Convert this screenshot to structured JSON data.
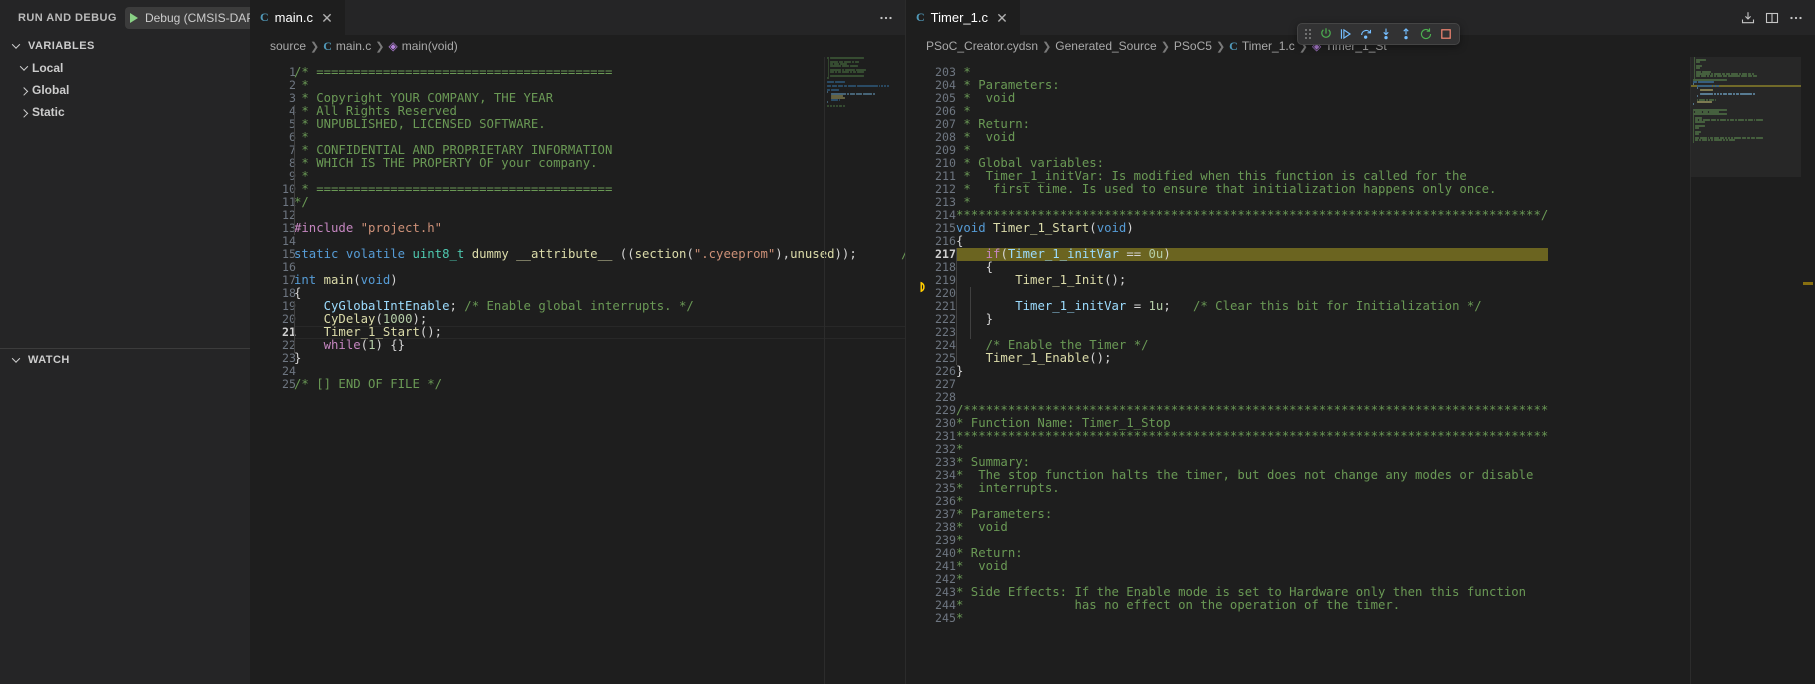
{
  "sidebar": {
    "title": "RUN AND DEBUG",
    "launch_config": "Debug (CMSIS-DAP)",
    "settings_icon": "gear-icon",
    "more_icon": "ellipsis-icon",
    "sections": [
      {
        "label": "VARIABLES",
        "expanded": true
      },
      {
        "label": "WATCH",
        "expanded": true
      }
    ],
    "variables_tree": [
      {
        "label": "Local",
        "expanded": true,
        "indent": 1
      },
      {
        "label": "Global",
        "expanded": false,
        "indent": 1
      },
      {
        "label": "Static",
        "expanded": false,
        "indent": 1
      }
    ]
  },
  "editor_left": {
    "tab": {
      "label": "main.c",
      "file_icon": "c-file-icon",
      "close_icon": "close-icon",
      "active": true
    },
    "tabbar_more_icon": "ellipsis-icon",
    "breadcrumbs": [
      "source",
      "main.c",
      "main(void)"
    ],
    "first_line": 1,
    "current_line": 21,
    "lines": [
      "/* ========================================",
      " *",
      " * Copyright YOUR COMPANY, THE YEAR",
      " * All Rights Reserved",
      " * UNPUBLISHED, LICENSED SOFTWARE.",
      " *",
      " * CONFIDENTIAL AND PROPRIETARY INFORMATION",
      " * WHICH IS THE PROPERTY OF your company.",
      " *",
      " * ========================================",
      "*/",
      "",
      "#include \"project.h\"",
      "",
      "static volatile uint8_t dummy __attribute__ ((section(\".cyeeprom\"),unused));      // Fix for lin",
      "",
      "int main(void)",
      "{",
      "    CyGlobalIntEnable; /* Enable global interrupts. */",
      "    CyDelay(1000);",
      "    Timer_1_Start();",
      "    while(1) {}",
      "}",
      "",
      "/* [] END OF FILE */"
    ]
  },
  "editor_right": {
    "tab": {
      "label": "Timer_1.c",
      "file_icon": "c-file-icon",
      "close_icon": "close-icon",
      "active": true
    },
    "breadcrumbs": [
      "PSoC_Creator.cydsn",
      "Generated_Source",
      "PSoC5",
      "Timer_1.c",
      "Timer_1_St"
    ],
    "actions": [
      {
        "name": "save-to-disk-icon"
      },
      {
        "name": "split-editor-icon"
      },
      {
        "name": "more-actions-icon"
      }
    ],
    "first_line": 203,
    "execution_line": 217,
    "lines": [
      " *",
      " * Parameters:",
      " *  void",
      " *",
      " * Return:",
      " *  void",
      " *",
      " * Global variables:",
      " *  Timer_1_initVar: Is modified when this function is called for the",
      " *   first time. Is used to ensure that initialization happens only once.",
      " *",
      "*******************************************************************************/",
      "void Timer_1_Start(void)",
      "{",
      "    if(Timer_1_initVar == 0u)",
      "    {",
      "        Timer_1_Init();",
      "",
      "        Timer_1_initVar = 1u;   /* Clear this bit for Initialization */",
      "    }",
      "",
      "    /* Enable the Timer */",
      "    Timer_1_Enable();",
      "}",
      "",
      "",
      "/*******************************************************************************",
      "* Function Name: Timer_1_Stop",
      "********************************************************************************",
      "*",
      "* Summary:",
      "*  The stop function halts the timer, but does not change any modes or disable",
      "*  interrupts.",
      "*",
      "* Parameters:",
      "*  void",
      "*",
      "* Return:",
      "*  void",
      "*",
      "* Side Effects: If the Enable mode is set to Hardware only then this function",
      "*               has no effect on the operation of the timer.",
      "*"
    ]
  },
  "debug_toolbar": {
    "grip": "drag-grip",
    "buttons": [
      {
        "name": "pause-button",
        "icon": "power-pause-icon",
        "color": "#4caf50"
      },
      {
        "name": "continue-button",
        "icon": "continue-icon",
        "color": "#75beff"
      },
      {
        "name": "step-over-button",
        "icon": "step-over-icon",
        "color": "#75beff"
      },
      {
        "name": "step-into-button",
        "icon": "step-into-icon",
        "color": "#75beff"
      },
      {
        "name": "step-out-button",
        "icon": "step-out-icon",
        "color": "#75beff"
      },
      {
        "name": "restart-button",
        "icon": "restart-icon",
        "color": "#4caf50"
      },
      {
        "name": "stop-button",
        "icon": "stop-icon",
        "color": "#f48771"
      }
    ]
  },
  "colors": {
    "background": "#1e1e1e",
    "sidebar_bg": "#252526",
    "tab_inactive": "#2d2d2d",
    "exec_line_highlight": "#6b6420",
    "exec_arrow": "#ffcc00",
    "accent_blue": "#519aba"
  }
}
